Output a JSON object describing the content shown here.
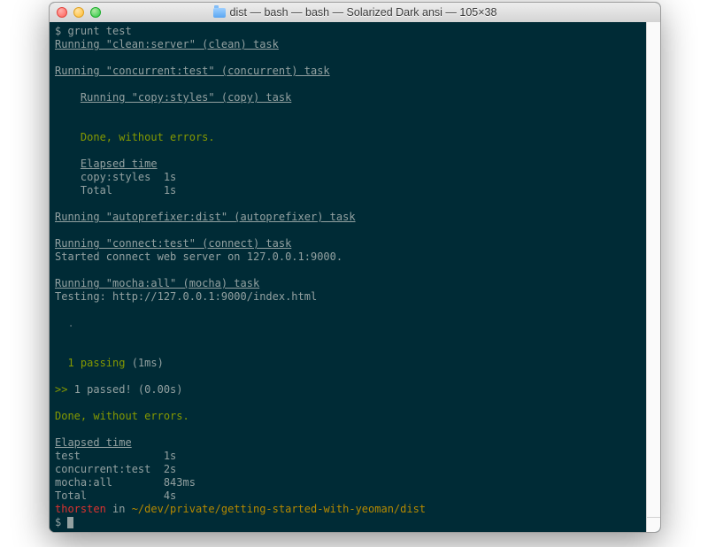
{
  "window": {
    "title": "dist — bash — bash — Solarized Dark ansi — 105×38"
  },
  "term": {
    "p1_prompt": "$ ",
    "p1_cmd": "grunt test",
    "l1": "Running \"clean:server\" (clean) task",
    "blank": "",
    "l2": "Running \"concurrent:test\" (concurrent) task",
    "l3_indent": "    ",
    "l3": "Running \"copy:styles\" (copy) task",
    "done": "Done, without errors.",
    "et": "Elapsed time",
    "et1": "copy:styles  1s",
    "et2": "Total        1s",
    "l4": "Running \"autoprefixer:dist\" (autoprefixer) task",
    "l5": "Running \"connect:test\" (connect) task",
    "l5b": "Started connect web server on 127.0.0.1:9000.",
    "l6": "Running \"mocha:all\" (mocha) task",
    "l6b": "Testing: http://127.0.0.1:9000/index.html",
    "dot": "  .",
    "pass1a": "  1 passing",
    "pass1b": " (1ms)",
    "pass2a": ">> ",
    "pass2b": "1 passed! (0.00s)",
    "ft1": "test             1s",
    "ft2": "concurrent:test  2s",
    "ft3": "mocha:all        843ms",
    "ft4": "Total            4s",
    "user": "thorsten",
    "in": " in ",
    "path": "~/dev/private/getting-started-with-yeoman/dist",
    "p2": "$ "
  }
}
